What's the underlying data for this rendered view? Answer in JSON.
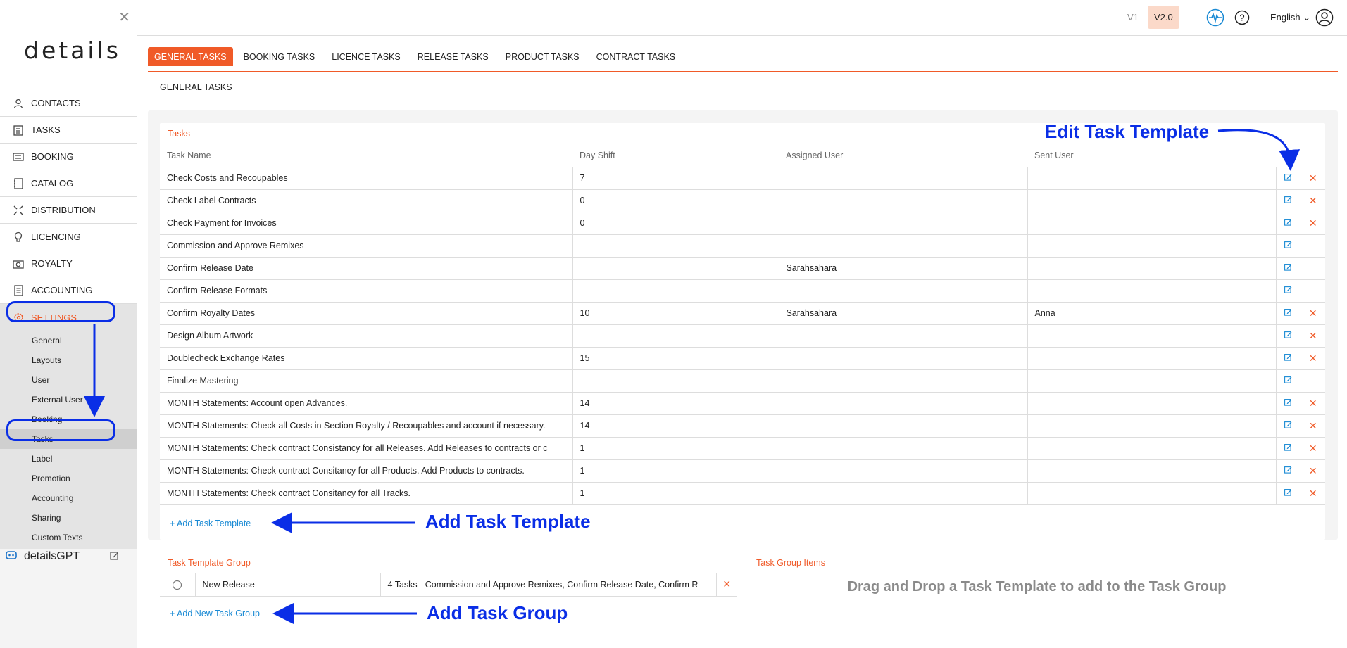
{
  "sidebar": {
    "logo": "details",
    "nav": [
      {
        "label": "CONTACTS",
        "icon": "person-icon"
      },
      {
        "label": "TASKS",
        "icon": "clipboard-icon"
      },
      {
        "label": "BOOKING",
        "icon": "ticket-icon"
      },
      {
        "label": "CATALOG",
        "icon": "catalog-icon"
      },
      {
        "label": "DISTRIBUTION",
        "icon": "distribution-icon"
      },
      {
        "label": "LICENCING",
        "icon": "bulb-icon"
      },
      {
        "label": "ROYALTY",
        "icon": "camera-icon"
      },
      {
        "label": "ACCOUNTING",
        "icon": "document-icon"
      },
      {
        "label": "SETTINGS",
        "icon": "gear-icon"
      }
    ],
    "settings_sub": [
      "General",
      "Layouts",
      "User",
      "External User",
      "Booking",
      "Tasks",
      "Label",
      "Promotion",
      "Accounting",
      "Sharing",
      "Custom Texts"
    ],
    "gpt_label_bold": "details",
    "gpt_label": "GPT"
  },
  "header": {
    "v1": "V1",
    "v2": "V2.0",
    "language": "English"
  },
  "tabs": [
    "GENERAL TASKS",
    "BOOKING TASKS",
    "LICENCE TASKS",
    "RELEASE TASKS",
    "PRODUCT TASKS",
    "CONTRACT TASKS"
  ],
  "subtitle": "GENERAL TASKS",
  "tasks": {
    "title": "Tasks",
    "columns": [
      "Task Name",
      "Day Shift",
      "Assigned User",
      "Sent User"
    ],
    "rows": [
      {
        "name": "Check Costs and Recoupables",
        "day": "7",
        "assigned": "",
        "sent": "",
        "del": true
      },
      {
        "name": "Check Label Contracts",
        "day": "0",
        "assigned": "",
        "sent": "",
        "del": true
      },
      {
        "name": "Check Payment for Invoices",
        "day": "0",
        "assigned": "",
        "sent": "",
        "del": true
      },
      {
        "name": "Commission and Approve Remixes",
        "day": "",
        "assigned": "",
        "sent": "",
        "del": false
      },
      {
        "name": "Confirm Release Date",
        "day": "",
        "assigned": "Sarahsahara",
        "sent": "",
        "del": false
      },
      {
        "name": "Confirm Release Formats",
        "day": "",
        "assigned": "",
        "sent": "",
        "del": false
      },
      {
        "name": "Confirm Royalty Dates",
        "day": "10",
        "assigned": "Sarahsahara",
        "sent": "Anna",
        "del": true
      },
      {
        "name": "Design Album Artwork",
        "day": "",
        "assigned": "",
        "sent": "",
        "del": true
      },
      {
        "name": "Doublecheck Exchange Rates",
        "day": "15",
        "assigned": "",
        "sent": "",
        "del": true
      },
      {
        "name": "Finalize Mastering",
        "day": "",
        "assigned": "",
        "sent": "",
        "del": false
      },
      {
        "name": "MONTH Statements: Account open Advances.",
        "day": "14",
        "assigned": "",
        "sent": "",
        "del": true
      },
      {
        "name": "MONTH Statements: Check all Costs in Section Royalty / Recoupables and account if necessary.",
        "day": "14",
        "assigned": "",
        "sent": "",
        "del": true
      },
      {
        "name": "MONTH Statements: Check contract Consistancy for all Releases. Add Releases to contracts or c",
        "day": "1",
        "assigned": "",
        "sent": "",
        "del": true
      },
      {
        "name": "MONTH Statements: Check contract Consitancy for all Products. Add Products to contracts.",
        "day": "1",
        "assigned": "",
        "sent": "",
        "del": true
      },
      {
        "name": "MONTH Statements: Check contract Consitancy for all Tracks.",
        "day": "1",
        "assigned": "",
        "sent": "",
        "del": true
      }
    ],
    "add_label": "+ Add Task Template"
  },
  "group": {
    "title": "Task Template Group",
    "rows": [
      {
        "name": "New Release",
        "summary": "4 Tasks - Commission and Approve Remixes, Confirm Release Date, Confirm R"
      }
    ],
    "add_label": "+ Add New Task Group"
  },
  "group_items": {
    "title": "Task Group Items",
    "hint": "Drag and Drop a Task Template to add to the Task Group"
  },
  "annotations": {
    "edit": "Edit Task Template",
    "add_template": "Add Task Template",
    "add_group": "Add Task Group"
  },
  "colors": {
    "accent": "#f05a28",
    "link": "#1a8ad4",
    "annotation": "#0a2ee6"
  }
}
